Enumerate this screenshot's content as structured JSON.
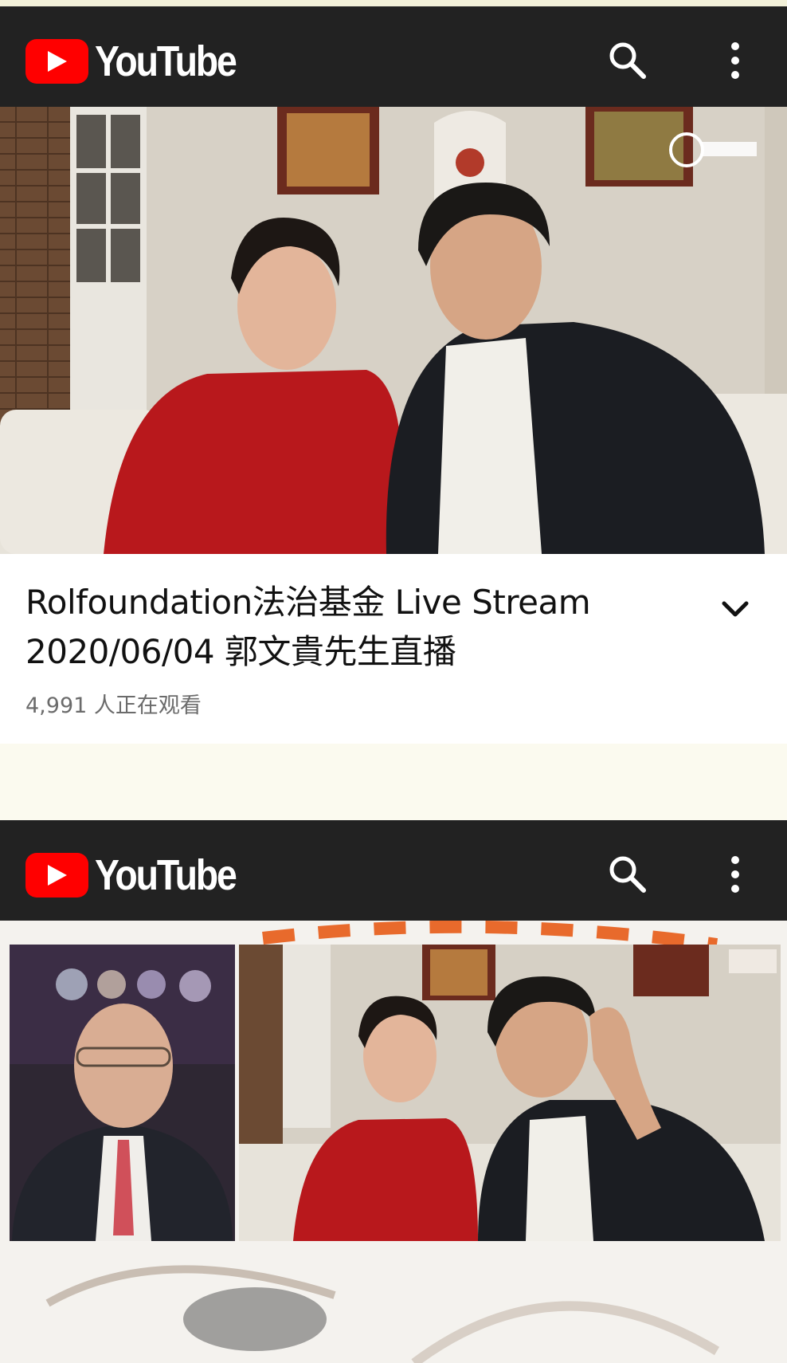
{
  "screenshots": [
    {
      "header": {
        "logo_text": "YouTube",
        "search_icon": "search-icon",
        "more_icon": "more-vert-icon"
      },
      "video": {
        "thumbnail_desc": "live stream video frame"
      },
      "info": {
        "title_line1": "Rolfoundation法治基金 Live Stream",
        "title_line2": "2020/06/04 郭文貴先生直播",
        "viewers": "4,991 人正在观看",
        "expand_icon": "chevron-down-icon"
      }
    },
    {
      "header": {
        "logo_text": "YouTube",
        "search_icon": "search-icon",
        "more_icon": "more-vert-icon"
      }
    }
  ],
  "colors": {
    "header_bg": "#222222",
    "brand_red": "#ff0000",
    "page_bg": "#fbfaef"
  }
}
